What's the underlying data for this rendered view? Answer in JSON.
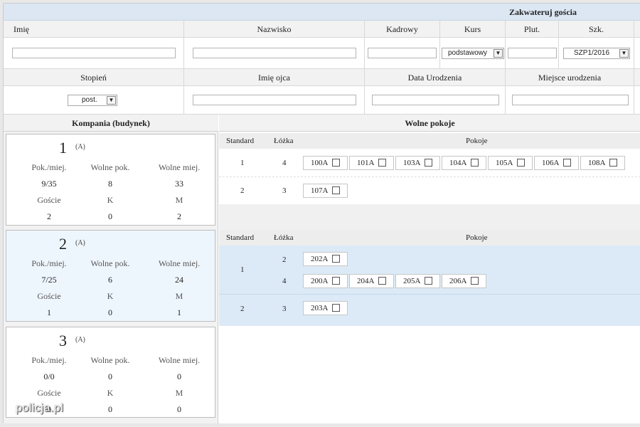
{
  "form": {
    "title": "Zakwateruj gościa",
    "row1_headers": [
      "Imię",
      "Nazwisko",
      "Kadrowy",
      "Kurs",
      "Plut.",
      "Szk."
    ],
    "kurs_value": "podstawowy",
    "szk_value": "SZP1/2016",
    "row2_headers": [
      "Stopień",
      "Imię ojca",
      "Data Urodzenia",
      "Miejsce urodzenia"
    ],
    "stopien_value": "post."
  },
  "companies_header": "Kompania (budynek)",
  "rooms_header": "Wolne pokoje",
  "stat_labels": {
    "pok": "Pok./miej.",
    "wolne_pok": "Wolne pok.",
    "wolne_miej": "Wolne miej.",
    "goscie": "Goście",
    "k": "K",
    "m": "M"
  },
  "companies": [
    {
      "num": "1",
      "tag": "(A)",
      "pok": "9/35",
      "wolne_pok": "8",
      "wolne_miej": "33",
      "goscie": "2",
      "k": "0",
      "m": "2"
    },
    {
      "num": "2",
      "tag": "(A)",
      "pok": "7/25",
      "wolne_pok": "6",
      "wolne_miej": "24",
      "goscie": "1",
      "k": "0",
      "m": "1"
    },
    {
      "num": "3",
      "tag": "(A)",
      "pok": "0/0",
      "wolne_pok": "0",
      "wolne_miej": "0",
      "goscie": "0",
      "k": "0",
      "m": "0"
    }
  ],
  "room_table_headers": {
    "standard": "Standard",
    "lozka": "Łóżka",
    "pokoje": "Pokoje"
  },
  "block1": {
    "rows": [
      {
        "standard": "1",
        "lozka": "4",
        "rooms": [
          "100A",
          "101A",
          "103A",
          "104A",
          "105A",
          "106A",
          "108A"
        ]
      },
      {
        "standard": "2",
        "lozka": "3",
        "rooms": [
          "107A"
        ]
      }
    ]
  },
  "block2": {
    "rows": [
      {
        "standard": "1",
        "sub": [
          {
            "lozka": "2",
            "rooms": [
              "202A"
            ]
          },
          {
            "lozka": "4",
            "rooms": [
              "200A",
              "204A",
              "205A",
              "206A"
            ]
          }
        ]
      },
      {
        "standard": "2",
        "lozka": "3",
        "rooms": [
          "203A"
        ]
      }
    ]
  },
  "watermark": "policja.pl",
  "colors": {
    "title_bar": "#dce7f3",
    "selected_row": "#dceaf7",
    "selected_company": "#eef6fd"
  }
}
